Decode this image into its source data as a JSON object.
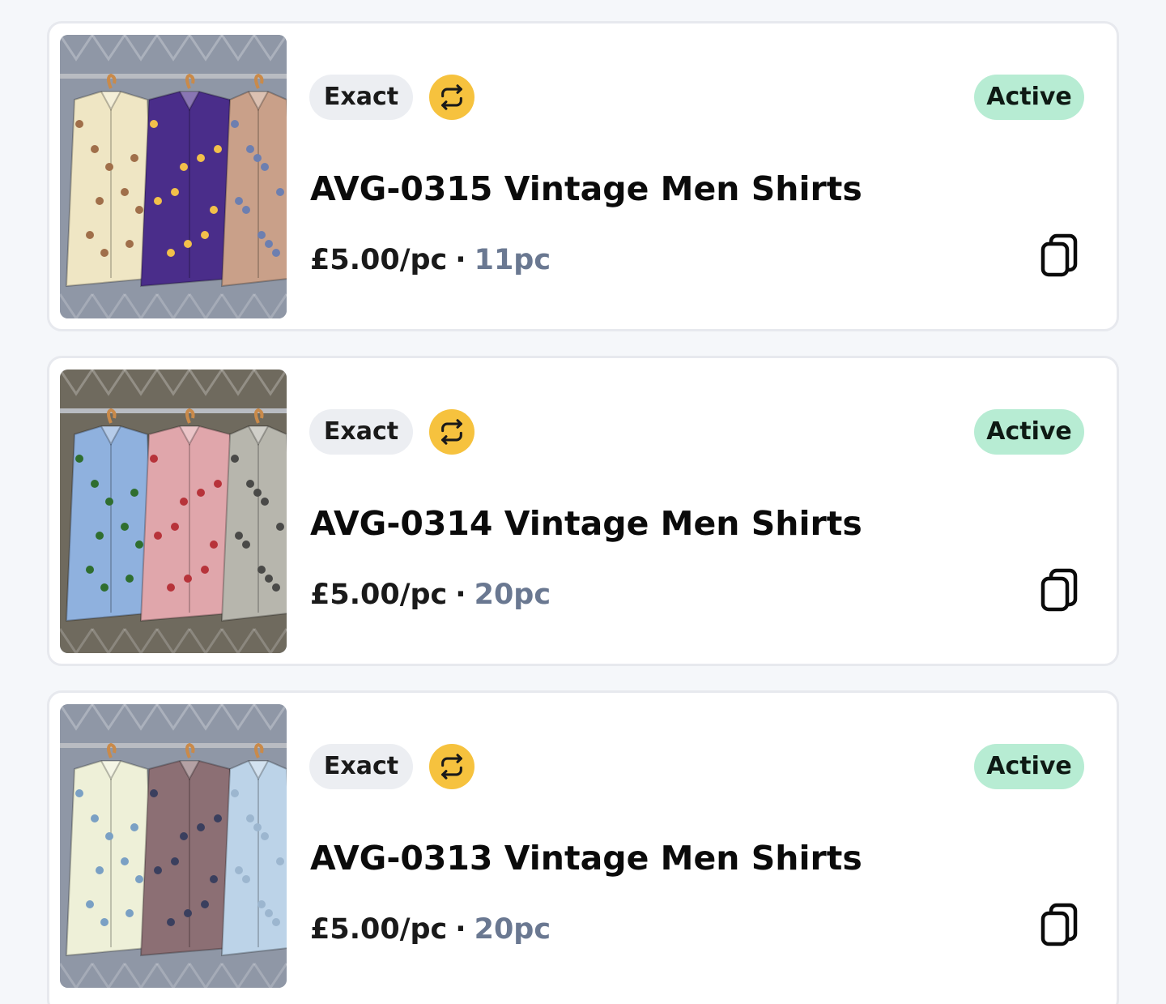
{
  "listings": [
    {
      "badge": "Exact",
      "status": "Active",
      "title": "AVG-0315 Vintage Men Shirts",
      "price": "£5.00/pc",
      "separator": "·",
      "quantity": "11pc",
      "photo": {
        "backdrop": "#8f97a6",
        "shirts": [
          "#efe6c4",
          "#4a2d8a",
          "#c9a089"
        ],
        "accents": [
          "#a06f4a",
          "#f2c04a",
          "#6d7fb0"
        ]
      }
    },
    {
      "badge": "Exact",
      "status": "Active",
      "title": "AVG-0314 Vintage Men Shirts",
      "price": "£5.00/pc",
      "separator": "·",
      "quantity": "20pc",
      "photo": {
        "backdrop": "#6f6a5e",
        "shirts": [
          "#8fb1de",
          "#e0a6ab",
          "#b7b6ad"
        ],
        "accents": [
          "#2f6e2f",
          "#b7333a",
          "#4a4a48"
        ]
      }
    },
    {
      "badge": "Exact",
      "status": "Active",
      "title": "AVG-0313 Vintage Men Shirts",
      "price": "£5.00/pc",
      "separator": "·",
      "quantity": "20pc",
      "photo": {
        "backdrop": "#8f97a6",
        "shirts": [
          "#eef0d8",
          "#8c6f74",
          "#bcd3e8"
        ],
        "accents": [
          "#7aa0c4",
          "#3a3f5e",
          "#9cb6cf"
        ]
      }
    }
  ],
  "icons": {
    "swap": "swap-arrows-icon",
    "copy": "copy-icon"
  },
  "colors": {
    "background": "#f5f7fa",
    "card": "#ffffff",
    "badge_exact_bg": "#eceef2",
    "swap_bg": "#f6c23e",
    "status_active_bg": "#b7ecd3",
    "quantity_text": "#6a7891"
  }
}
